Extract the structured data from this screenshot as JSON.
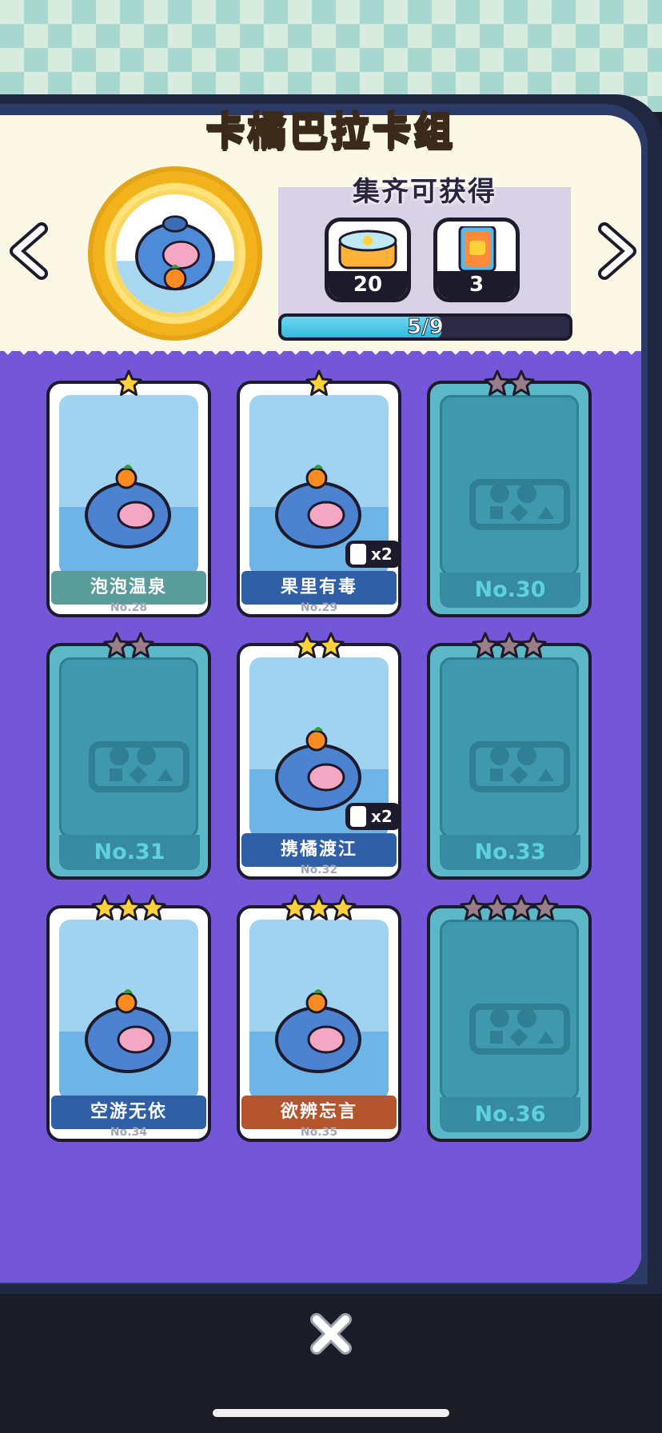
{
  "header": {
    "title": "卡橘巴拉卡组"
  },
  "reward": {
    "title": "集齐可获得",
    "items": [
      {
        "icon": "chest-icon",
        "count": "20"
      },
      {
        "icon": "card-pack-icon",
        "count": "3"
      }
    ],
    "progress_text": "5/9",
    "progress": {
      "value": 5,
      "max": 9
    }
  },
  "cards": [
    {
      "stars": 1,
      "owned": true,
      "name": "泡泡温泉",
      "no": "No.28",
      "ribbon_color": "#5a9c9a",
      "badge": null
    },
    {
      "stars": 1,
      "owned": true,
      "name": "果里有毒",
      "no": "No.29",
      "ribbon_color": "#2f5fa6",
      "badge": "x2"
    },
    {
      "stars": 2,
      "owned": false,
      "name": "",
      "no": "No.30",
      "ribbon_color": "",
      "badge": null
    },
    {
      "stars": 2,
      "owned": false,
      "name": "",
      "no": "No.31",
      "ribbon_color": "",
      "badge": null
    },
    {
      "stars": 2,
      "owned": true,
      "name": "携橘渡江",
      "no": "No.32",
      "ribbon_color": "#2f5fa6",
      "badge": "x2"
    },
    {
      "stars": 3,
      "owned": false,
      "name": "",
      "no": "No.33",
      "ribbon_color": "",
      "badge": null
    },
    {
      "stars": 3,
      "owned": true,
      "name": "空游无依",
      "no": "No.34",
      "ribbon_color": "#2f5fa6",
      "badge": null
    },
    {
      "stars": 3,
      "owned": true,
      "name": "欲辨忘言",
      "no": "No.35",
      "ribbon_color": "#b4552e",
      "badge": null
    },
    {
      "stars": 4,
      "owned": false,
      "name": "",
      "no": "No.36",
      "ribbon_color": "",
      "badge": null
    }
  ],
  "colors": {
    "star_gold": "#ffd23a",
    "star_locked": "#9a7f88",
    "panel_purple": "#7457d8",
    "locked_card": "#5cb8c6"
  }
}
